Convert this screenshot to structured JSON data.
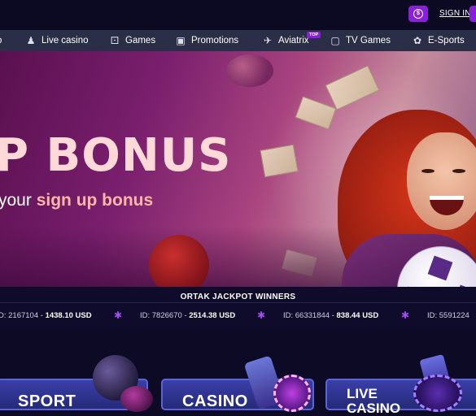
{
  "header": {
    "currency_icon": "dollar-coin-icon",
    "sign_in": "SIGN IN"
  },
  "nav": {
    "items": [
      {
        "label": "Live casino",
        "icon": "dealer-icon"
      },
      {
        "label": "Games",
        "icon": "dice-icon"
      },
      {
        "label": "Promotions",
        "icon": "gift-icon"
      },
      {
        "label": "Aviatrix",
        "icon": "plane-icon",
        "badge": "TOP"
      },
      {
        "label": "TV Games",
        "icon": "tv-icon"
      },
      {
        "label": "E-Sports",
        "icon": "esports-icon"
      }
    ]
  },
  "hero": {
    "title": "P BONUS",
    "subtitle_pre": "your ",
    "subtitle_highlight": "sign up bonus"
  },
  "jackpot": {
    "heading": "ORTAK JACKPOT WINNERS",
    "entries": [
      {
        "id": "D: 2167104 -",
        "amount": "1438.10 USD"
      },
      {
        "id": "ID: 7826670 -",
        "amount": "2514.38 USD"
      },
      {
        "id": "ID: 66331844 -",
        "amount": "838.44 USD"
      },
      {
        "id": "ID: 5591224",
        "amount": ""
      }
    ]
  },
  "categories": [
    {
      "label": "SPORT"
    },
    {
      "label": "CASINO"
    },
    {
      "label_line1": "LIVE",
      "label_line2": "CASINO"
    }
  ],
  "colors": {
    "accent": "#8a1fd8",
    "nav_bg": "#2a2f47",
    "page_bg": "#0d0a26"
  }
}
